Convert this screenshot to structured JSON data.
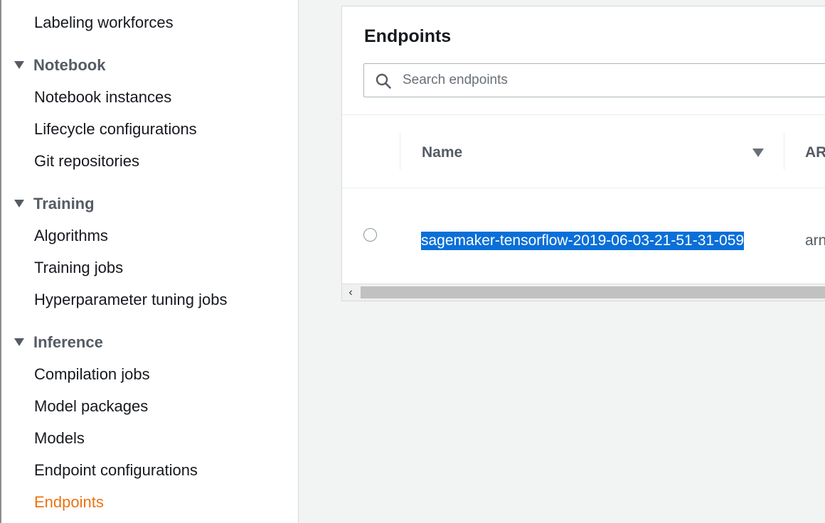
{
  "sidebar": {
    "items": [
      {
        "label": "Labeling workforces",
        "kind": "item"
      },
      {
        "label": "Notebook",
        "kind": "section"
      },
      {
        "label": "Notebook instances",
        "kind": "item"
      },
      {
        "label": "Lifecycle configurations",
        "kind": "item"
      },
      {
        "label": "Git repositories",
        "kind": "item"
      },
      {
        "label": "Training",
        "kind": "section"
      },
      {
        "label": "Algorithms",
        "kind": "item"
      },
      {
        "label": "Training jobs",
        "kind": "item"
      },
      {
        "label": "Hyperparameter tuning jobs",
        "kind": "item"
      },
      {
        "label": "Inference",
        "kind": "section"
      },
      {
        "label": "Compilation jobs",
        "kind": "item"
      },
      {
        "label": "Model packages",
        "kind": "item"
      },
      {
        "label": "Models",
        "kind": "item"
      },
      {
        "label": "Endpoint configurations",
        "kind": "item"
      },
      {
        "label": "Endpoints",
        "kind": "item",
        "active": true
      }
    ],
    "active_color": "#ec7211"
  },
  "main": {
    "title": "Endpoints",
    "search": {
      "placeholder": "Search endpoints",
      "value": "",
      "icon": "search-icon"
    },
    "table": {
      "columns": [
        "Name",
        "ARN"
      ],
      "rows": [
        {
          "name": "sagemaker-tensorflow-2019-06-03-21-51-31-059",
          "arn": "arn",
          "selected": false
        }
      ],
      "sort_icon": "caret-down-icon"
    },
    "scrollbar": {
      "left_arrow": "‹"
    }
  },
  "colors": {
    "selection_highlight": "#0a6fd8",
    "text_primary": "#16191f",
    "text_secondary": "#545b64",
    "background": "#f2f3f3"
  }
}
